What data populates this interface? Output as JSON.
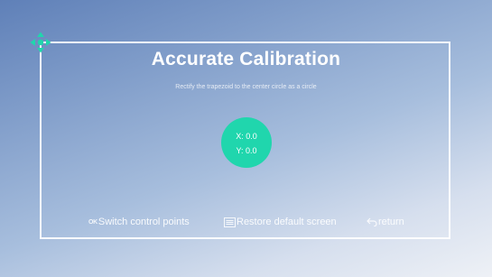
{
  "calibration": {
    "title": "Accurate Calibration",
    "subtitle": "Rectify the trapezoid to the center circle as a circle",
    "x_readout": "X: 0.0",
    "y_readout": "Y: 0.0"
  },
  "actions": {
    "switch_icon_text": "OK",
    "switch_label": "Switch control points",
    "restore_label": "Restore default screen",
    "return_label": "return"
  },
  "icons": {
    "control_point": "four-way-arrow-icon",
    "switch": "ok-icon",
    "restore": "menu-icon",
    "return": "return-arrow-icon"
  },
  "colors": {
    "accent": "#20d6ad",
    "frame": "#ffffff",
    "background_top": "#5f80b8",
    "background_bottom": "#eef1f6"
  }
}
